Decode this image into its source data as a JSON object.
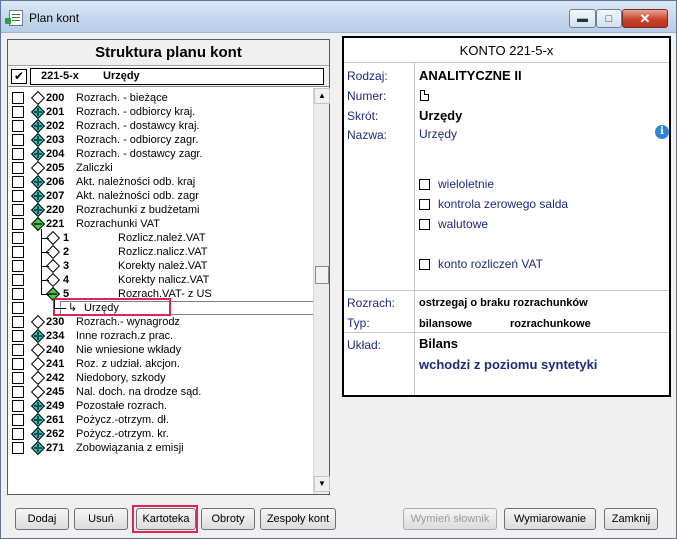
{
  "window": {
    "title": "Plan kont"
  },
  "titlebar_buttons": {
    "minimize": "▬",
    "maximize": "□",
    "close": "✕"
  },
  "tree": {
    "header": "Struktura planu kont",
    "current": {
      "code": "221-5-x",
      "name": "Urzędy"
    },
    "rows": [
      {
        "num": "200",
        "label": "Rozrach. - bieżące",
        "node": "empty",
        "level": 0
      },
      {
        "num": "201",
        "label": "Rozrach. - odbiorcy kraj.",
        "node": "plus",
        "level": 0
      },
      {
        "num": "202",
        "label": "Rozrach. - dostawcy kraj.",
        "node": "plus",
        "level": 0
      },
      {
        "num": "203",
        "label": "Rozrach. - odbiorcy zagr.",
        "node": "plus",
        "level": 0
      },
      {
        "num": "204",
        "label": "Rozrach. - dostawcy zagr.",
        "node": "plus",
        "level": 0
      },
      {
        "num": "205",
        "label": "Zaliczki",
        "node": "empty",
        "level": 0
      },
      {
        "num": "206",
        "label": "Akt. należności odb. kraj",
        "node": "plus",
        "level": 0
      },
      {
        "num": "207",
        "label": "Akt. należności odb. zagr",
        "node": "plus",
        "level": 0
      },
      {
        "num": "220",
        "label": "Rozrachunki z budżetami",
        "node": "plus",
        "level": 0
      },
      {
        "num": "221",
        "label": "Rozrachunki VAT",
        "node": "minus",
        "level": 0
      },
      {
        "num": "1",
        "label": "Rozlicz.należ.VAT",
        "node": "empty",
        "level": 1
      },
      {
        "num": "2",
        "label": "Rozlicz.nalicz.VAT",
        "node": "empty",
        "level": 1
      },
      {
        "num": "3",
        "label": "Korekty należ.VAT",
        "node": "empty",
        "level": 1
      },
      {
        "num": "4",
        "label": "Korekty nalicz.VAT",
        "node": "empty",
        "level": 1
      },
      {
        "num": "5",
        "label": "Rozrach.VAT- z US",
        "node": "minus",
        "level": 1
      },
      {
        "num": "",
        "label": "Urzędy",
        "node": "leaf",
        "level": 2
      },
      {
        "num": "230",
        "label": "Rozrach.- wynagrodz",
        "node": "empty",
        "level": 0
      },
      {
        "num": "234",
        "label": "Inne rozrach.z prac.",
        "node": "plus",
        "level": 0
      },
      {
        "num": "240",
        "label": "Nie wniesione wkłady",
        "node": "empty",
        "level": 0
      },
      {
        "num": "241",
        "label": "Roz. z udział. akcjon.",
        "node": "empty",
        "level": 0
      },
      {
        "num": "242",
        "label": "Niedobory, szkody",
        "node": "empty",
        "level": 0
      },
      {
        "num": "245",
        "label": "Nal. doch. na drodze sąd.",
        "node": "empty",
        "level": 0
      },
      {
        "num": "249",
        "label": "Pozostałe rozrach.",
        "node": "plus",
        "level": 0
      },
      {
        "num": "261",
        "label": "Pożycz.-otrzym. dł.",
        "node": "plus",
        "level": 0
      },
      {
        "num": "262",
        "label": "Pożycz.-otrzym. kr.",
        "node": "plus",
        "level": 0
      },
      {
        "num": "271",
        "label": "Zobowiązania z emisji",
        "node": "plus",
        "level": 0
      }
    ]
  },
  "scrollbar": {
    "up": "▲",
    "down": "▼"
  },
  "detail": {
    "title": "KONTO  221-5-x",
    "labels": {
      "rodzaj": "Rodzaj:",
      "numer": "Numer:",
      "skrot": "Skrót:",
      "nazwa": "Nazwa:",
      "rozrach": "Rozrach:",
      "typ": "Typ:",
      "uklad": "Układ:"
    },
    "rodzaj_value": "ANALITYCZNE    II",
    "skrot_value": "Urzędy",
    "nazwa_value": "Urzędy",
    "options": [
      "wieloletnie",
      "kontrola zerowego salda",
      "walutowe",
      "konto rozliczeń VAT"
    ],
    "rozrach_value": "ostrzegaj o braku rozrachunków",
    "typ_value_1": "bilansowe",
    "typ_value_2": "rozrachunkowe",
    "uklad_value": "Bilans",
    "uklad_note": "wchodzi z poziomu syntetyki",
    "info_glyph": "i"
  },
  "buttons": {
    "dodaj": "Dodaj",
    "usun": "Usuń",
    "kartoteka": "Kartoteka",
    "obroty": "Obroty",
    "zespoly": "Zespoły kont",
    "wymien": "Wymień słownik",
    "wymiarowanie": "Wymiarowanie",
    "zamknij": "Zamknij"
  }
}
